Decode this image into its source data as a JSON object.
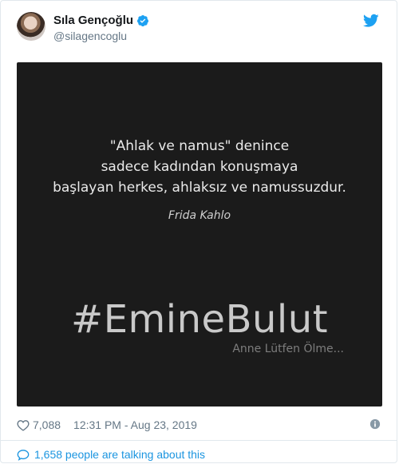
{
  "header": {
    "display_name": "Sıla Gençoğlu",
    "handle": "@silagencoglu"
  },
  "media": {
    "quote_lines": [
      "\"Ahlak ve namus\" denince",
      "sadece kadından konuşmaya",
      "başlayan herkes, ahlaksız ve namussuzdur."
    ],
    "author": "Frida Kahlo",
    "hashtag": "#EmineBulut",
    "subtitle": "Anne Lütfen Ölme..."
  },
  "meta": {
    "likes": "7,088",
    "timestamp": "12:31 PM - Aug 23, 2019"
  },
  "footer": {
    "talking": "1,658 people are talking about this"
  },
  "colors": {
    "accent": "#1b95e0",
    "muted": "#657786",
    "media_bg": "#1b1b1b"
  },
  "icons": {
    "verified": "verified-badge-icon",
    "logo": "twitter-bird-icon",
    "like": "heart-icon",
    "info": "info-icon",
    "comments": "speech-bubble-icon"
  }
}
